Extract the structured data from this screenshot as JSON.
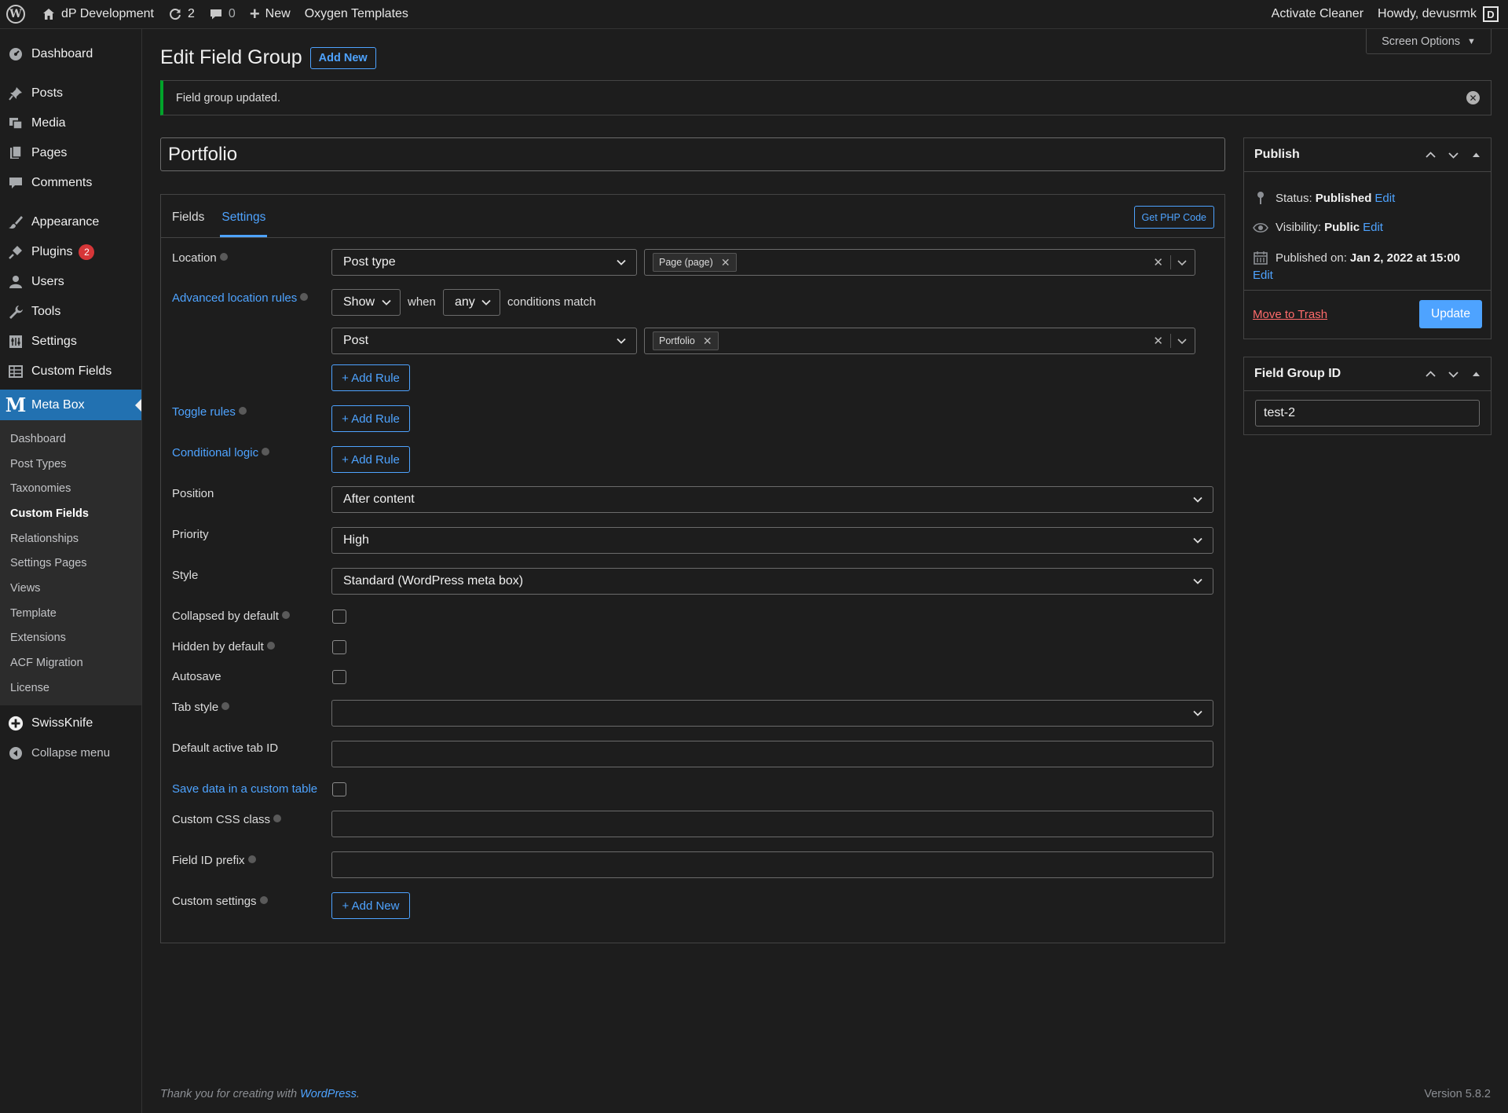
{
  "admin_bar": {
    "site_name": "dP Development",
    "updates_count": "2",
    "comments_count": "0",
    "new_label": "New",
    "oxygen_label": "Oxygen Templates",
    "activate_cleaner": "Activate Cleaner",
    "howdy": "Howdy, devusrmk",
    "avatar_letter": "D"
  },
  "sidebar": {
    "items": [
      {
        "label": "Dashboard",
        "icon": "dashboard-icon"
      },
      {
        "label": "Posts",
        "icon": "pin-icon"
      },
      {
        "label": "Media",
        "icon": "media-icon"
      },
      {
        "label": "Pages",
        "icon": "pages-icon"
      },
      {
        "label": "Comments",
        "icon": "comment-icon"
      },
      {
        "label": "Appearance",
        "icon": "brush-icon"
      },
      {
        "label": "Plugins",
        "icon": "plug-icon",
        "badge": "2"
      },
      {
        "label": "Users",
        "icon": "user-icon"
      },
      {
        "label": "Tools",
        "icon": "wrench-icon"
      },
      {
        "label": "Settings",
        "icon": "settings-icon"
      },
      {
        "label": "Custom Fields",
        "icon": "table-icon"
      }
    ],
    "active": {
      "label": "Meta Box",
      "icon_letter": "M"
    },
    "submenu": [
      "Dashboard",
      "Post Types",
      "Taxonomies",
      "Custom Fields",
      "Relationships",
      "Settings Pages",
      "Views",
      "Template",
      "Extensions",
      "ACF Migration",
      "License"
    ],
    "submenu_current": "Custom Fields",
    "swissknife": "SwissKnife",
    "collapse": "Collapse menu"
  },
  "header": {
    "screen_options": "Screen Options",
    "title": "Edit Field Group",
    "add_new": "Add New",
    "notice": "Field group updated."
  },
  "title_field": {
    "value": "Portfolio"
  },
  "settings": {
    "tabs": [
      "Fields",
      "Settings"
    ],
    "active_tab": "Settings",
    "php_button": "Get PHP Code",
    "location_label": "Location",
    "location_select": "Post type",
    "location_tag": "Page (page)",
    "advanced_label": "Advanced location rules",
    "show_select": "Show",
    "when_text": "when",
    "any_select": "any",
    "conditions_text": "conditions match",
    "rule_select": "Post",
    "rule_tag": "Portfolio",
    "add_rule": "+ Add Rule",
    "toggle_label": "Toggle rules",
    "conditional_label": "Conditional logic",
    "position_label": "Position",
    "position_value": "After content",
    "priority_label": "Priority",
    "priority_value": "High",
    "style_label": "Style",
    "style_value": "Standard (WordPress meta box)",
    "collapsed_label": "Collapsed by default",
    "hidden_label": "Hidden by default",
    "autosave_label": "Autosave",
    "tab_style_label": "Tab style",
    "tab_style_value": "",
    "default_tab_label": "Default active tab ID",
    "custom_table_label": "Save data in a custom table",
    "css_class_label": "Custom CSS class",
    "prefix_label": "Field ID prefix",
    "custom_settings_label": "Custom settings",
    "add_new": "+ Add New"
  },
  "publish": {
    "title": "Publish",
    "status_label": "Status:",
    "status_value": "Published",
    "visibility_label": "Visibility:",
    "visibility_value": "Public",
    "published_label": "Published on:",
    "published_value": "Jan 2, 2022 at 15:00",
    "edit": "Edit",
    "trash": "Move to Trash",
    "update": "Update"
  },
  "field_group_id": {
    "title": "Field Group ID",
    "value": "test-2"
  },
  "footer": {
    "thanks_prefix": "Thank you for creating with",
    "wordpress_link": "WordPress",
    "thanks_suffix": ".",
    "version": "Version 5.8.2"
  }
}
